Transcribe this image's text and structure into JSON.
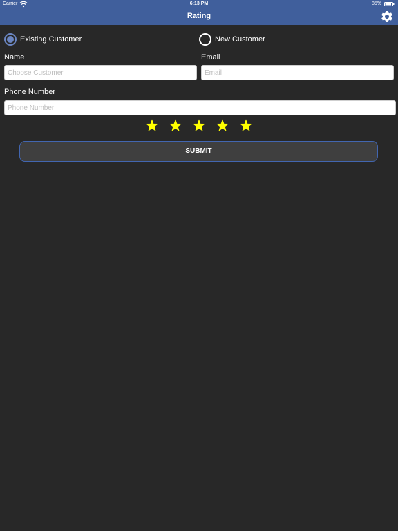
{
  "status_bar": {
    "carrier": "Carrier",
    "time": "6:13 PM",
    "battery": "85%",
    "wifi_icon": "wifi-icon",
    "battery_icon": "battery-icon"
  },
  "nav": {
    "title": "Rating",
    "settings_icon": "gear-icon"
  },
  "customer_type": {
    "options": [
      {
        "label": "Existing Customer",
        "selected": true
      },
      {
        "label": "New Customer",
        "selected": false
      }
    ]
  },
  "form": {
    "name": {
      "label": "Name",
      "placeholder": "Choose Customer",
      "value": ""
    },
    "email": {
      "label": "Email",
      "placeholder": "Email",
      "value": ""
    },
    "phone": {
      "label": "Phone Number",
      "placeholder": "Phone Number",
      "value": ""
    }
  },
  "rating": {
    "max": 5,
    "value": 5,
    "star_icon": "star-icon"
  },
  "submit_label": "SUBMIT",
  "colors": {
    "background": "#282828",
    "nav_bar": "#405f9c",
    "star": "#ffff00",
    "radio_selected": "#6b86c2",
    "button_border": "#4266b0"
  }
}
